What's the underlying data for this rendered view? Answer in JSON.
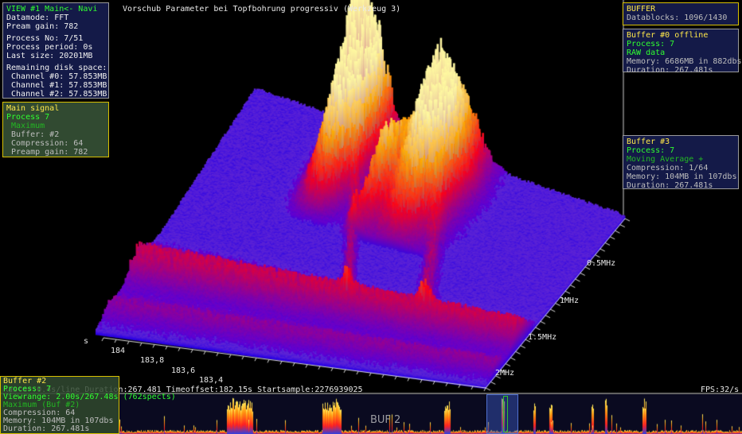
{
  "title": "Vorschub Parameter bei Topfbohrung progressiv (Werkzeug 3)",
  "view_panel": {
    "header": "VIEW #1 Main<- Navi",
    "datamode": "Datamode: FFT",
    "pream_gain": "Pream gain: 782",
    "process_no": "Process No: 7/51",
    "process_period": "Process period: 0s",
    "last_size": "Last size: 20201MB",
    "disk_header": "Remaining disk space:",
    "channels": [
      " Channel #0: 57.853MB",
      " Channel #1: 57.853MB",
      " Channel #2: 57.853MB"
    ]
  },
  "main_signal": {
    "header": "Main signal",
    "process": "Process 7",
    "mode": " Maximum",
    "buffer": " Buffer: #2",
    "compression": " Compression: 64",
    "preamp": " Preamp gain: 782"
  },
  "buffer_panel": {
    "header": "BUFFER",
    "datablocks": "Datablocks: 1096/1430"
  },
  "buffer0": {
    "header": "Buffer #0 offline",
    "process": "Process: 7",
    "raw": "RAW data",
    "memory": "Memory: 6686MB in 882dbs",
    "duration": "Duration: 267.481s"
  },
  "buffer3": {
    "header": "Buffer #3",
    "process": "Process: 7",
    "mode": "Moving Average +",
    "compression": "Compression: 1/64",
    "memory": "Memory: 104MB in 107dbs",
    "duration": "Duration: 267.481s"
  },
  "buffer2": {
    "header": "Buffer #2",
    "process": "Process: 7",
    "viewrange": "Viewrange: 2.00s/267.48s (762spects)",
    "mode": "Maximum (Buf #2)",
    "compression": "Compression: 64",
    "memory": "Memory: 104MB in 107dbs",
    "duration": "Duration: 267.481s"
  },
  "status": {
    "raster": "Raster:0.4s/line Duration:267.481 Timeoffset:182.15s  Startsample:2276939025",
    "fps": "FPS:32/s"
  },
  "axis": {
    "time_unit": "s",
    "time_ticks": [
      "184",
      "183,8",
      "183,6",
      "183,4"
    ],
    "freq_ticks": [
      "0.5MHz",
      "1MHz",
      "1.5MHz",
      "2MHz"
    ]
  },
  "minimap_label": "BUF 2",
  "colors": {
    "navy_panel": "#141a48",
    "green_panel": "#314a31",
    "highlight": "#ffe84a",
    "status_green": "#30ff30"
  }
}
